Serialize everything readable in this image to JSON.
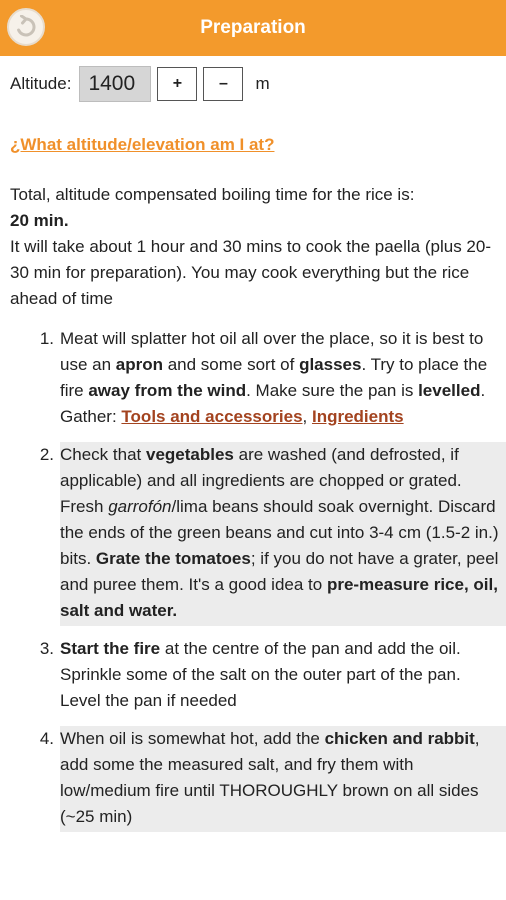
{
  "header": {
    "title": "Preparation",
    "back_icon": "back-arrow-icon"
  },
  "altitude": {
    "label": "Altitude:",
    "value": "1400",
    "plus": "+",
    "minus": "–",
    "unit": "m"
  },
  "link": {
    "text": "¿What altitude/elevation am I at?"
  },
  "summary": {
    "line1": "Total, altitude compensated boiling time for the rice is:",
    "time": "20 min.",
    "line2": "It will take about 1 hour and 30 mins to cook the paella (plus 20-30 min for preparation). You may cook everything but the rice ahead of time"
  },
  "steps": [
    {
      "num": "1.",
      "p1": "Meat will splatter hot oil all over the place, so it is best to use an ",
      "b1": "apron",
      "p2": " and some sort of ",
      "b2": "glasses",
      "p3": ". Try to place the fire ",
      "b3": "away from the wind",
      "p4": ". Make sure the pan is ",
      "b4": "levelled",
      "p5": ". Gather: ",
      "link1": "Tools and accessories",
      "sep": ", ",
      "link2": "Ingredients"
    },
    {
      "num": "2.",
      "p1": "Check that ",
      "b1": "vegetables",
      "p2": " are washed (and defrosted, if applicable) and all ingredients are chopped or grated. Fresh ",
      "i1": "garrofón",
      "p3": "/lima beans should soak overnight. Discard the ends of the green beans and cut into 3-4 cm (1.5-2 in.) bits. ",
      "b2": "Grate the tomatoes",
      "p4": "; if you do not have a grater, peel and puree them. It's a good idea to ",
      "b3": "pre-measure rice, oil, salt and water."
    },
    {
      "num": "3.",
      "b1": "Start the fire",
      "p1": " at the centre of the pan and add the oil. Sprinkle some of the salt on the outer part of the pan. Level the pan if needed"
    },
    {
      "num": "4.",
      "p1": "When oil is somewhat hot, add the ",
      "b1": "chicken and rabbit",
      "p2": ", add some the measured salt, and fry them with low/medium fire until THOROUGHLY brown on all sides (~25 min)"
    }
  ]
}
